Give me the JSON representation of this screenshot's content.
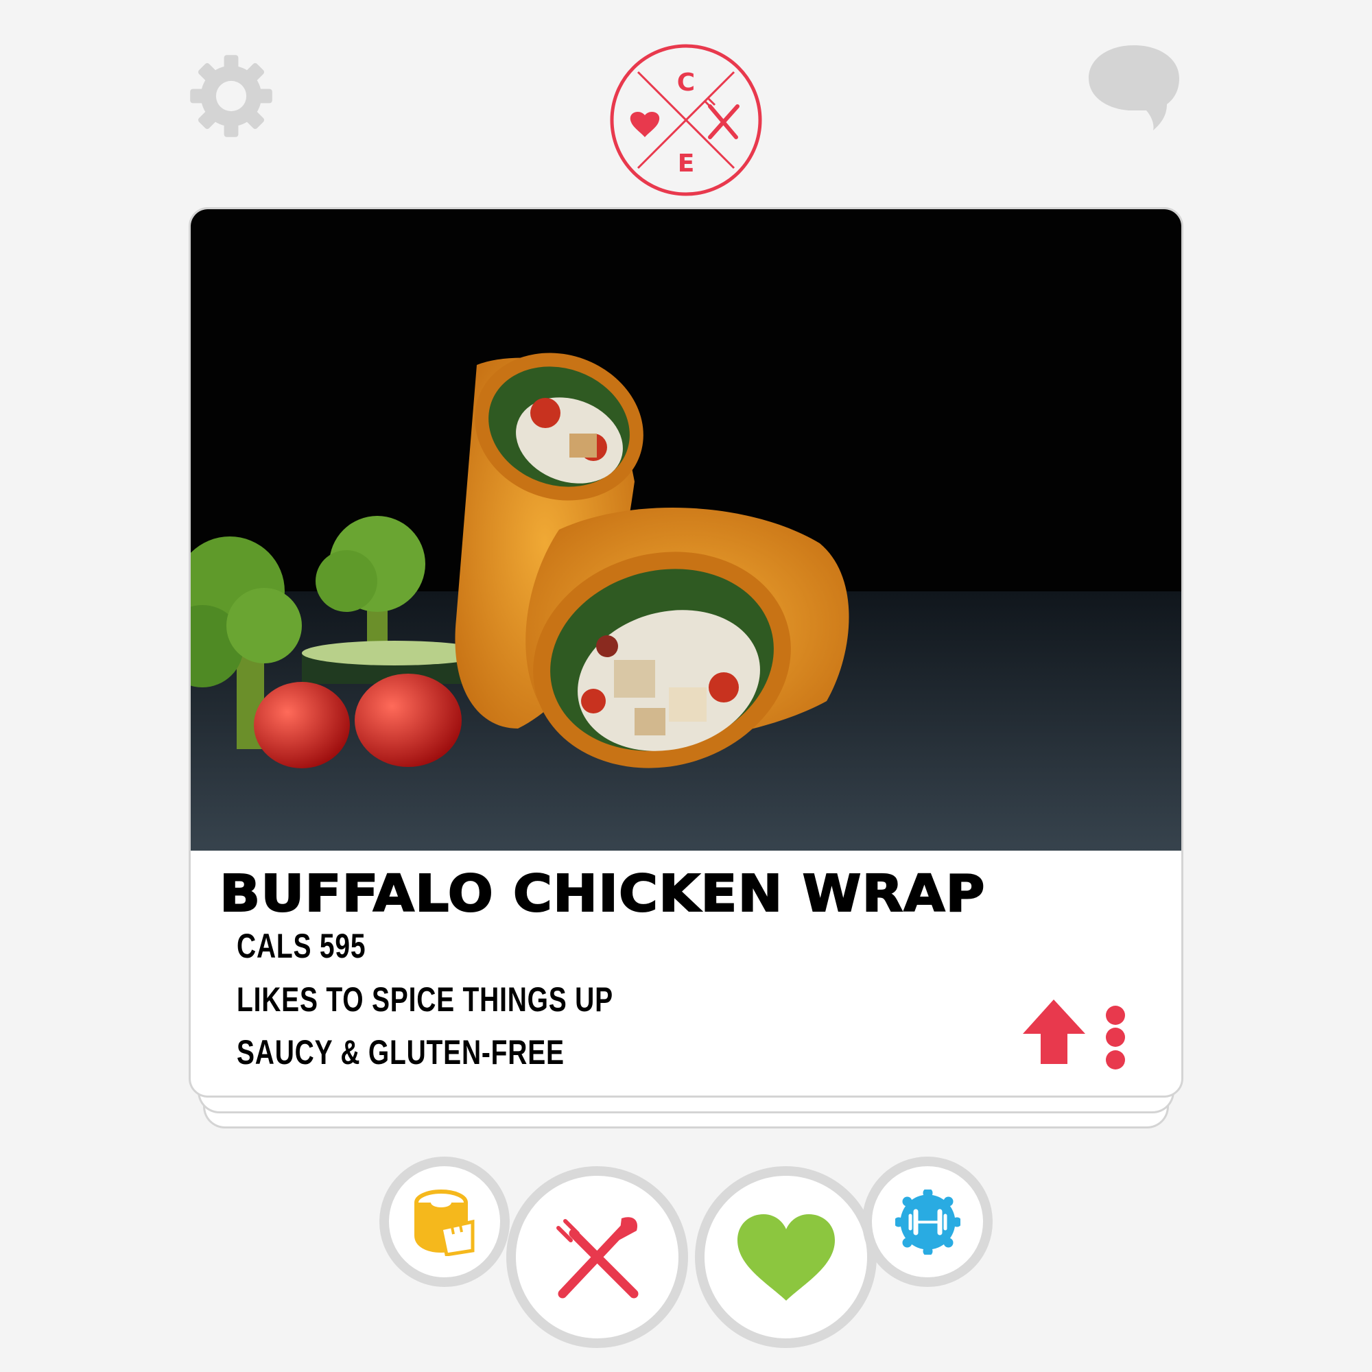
{
  "header": {
    "settings_icon": "gear-icon",
    "messages_icon": "chat-bubble-icon",
    "logo": {
      "letters_top": "C",
      "letters_bottom": "E",
      "left_symbol": "heart-icon",
      "right_symbol": "fork-knife-icon",
      "color": "#e8394d"
    }
  },
  "card": {
    "image": "buffalo chicken wrap photo",
    "title": "BUFFALO CHICKEN WRAP",
    "facts": [
      "CALS 595",
      "LIKES TO SPICE THINGS UP",
      "SAUCY & GLUTEN-FREE"
    ],
    "info_icon": "up-arrow-icon",
    "more_icon": "more-vertical-icon"
  },
  "actions": {
    "measure": {
      "icon": "measuring-tape-icon",
      "color": "#f5b81c"
    },
    "nope": {
      "icon": "fork-knife-cross-icon",
      "color": "#e8394d"
    },
    "like": {
      "icon": "heart-icon",
      "color": "#8cc63f"
    },
    "boost": {
      "icon": "dumbbell-badge-icon",
      "color": "#29abe2"
    }
  },
  "colors": {
    "background": "#f4f4f4",
    "accent": "#e8394d",
    "muted_icon": "#d4d4d4"
  }
}
